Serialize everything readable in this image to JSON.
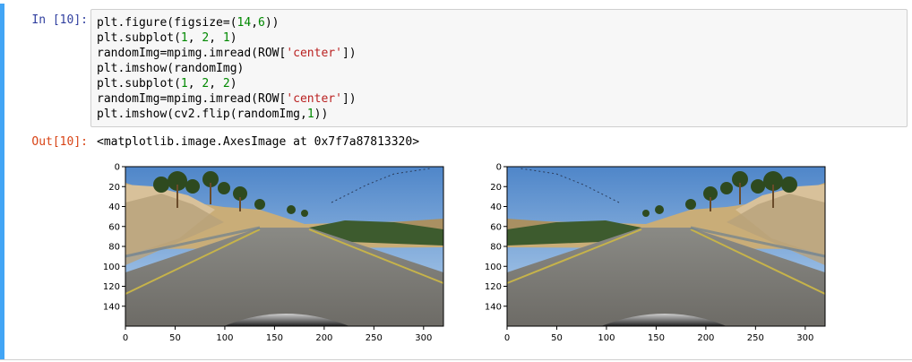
{
  "cell": {
    "in_prompt": "In [10]:",
    "out_prompt": "Out[10]:",
    "code_lines": [
      [
        {
          "t": "plt.figure(figsize=("
        },
        {
          "t": "14",
          "c": "num"
        },
        {
          "t": ","
        },
        {
          "t": "6",
          "c": "num"
        },
        {
          "t": "))"
        }
      ],
      [
        {
          "t": "plt.subplot("
        },
        {
          "t": "1",
          "c": "num"
        },
        {
          "t": ", "
        },
        {
          "t": "2",
          "c": "num"
        },
        {
          "t": ", "
        },
        {
          "t": "1",
          "c": "num"
        },
        {
          "t": ")"
        }
      ],
      [
        {
          "t": "randomImg=mpimg.imread(ROW["
        },
        {
          "t": "'center'",
          "c": "str"
        },
        {
          "t": "])"
        }
      ],
      [
        {
          "t": "plt.imshow(randomImg)"
        }
      ],
      [
        {
          "t": "plt.subplot("
        },
        {
          "t": "1",
          "c": "num"
        },
        {
          "t": ", "
        },
        {
          "t": "2",
          "c": "num"
        },
        {
          "t": ", "
        },
        {
          "t": "2",
          "c": "num"
        },
        {
          "t": ")"
        }
      ],
      [
        {
          "t": "randomImg=mpimg.imread(ROW["
        },
        {
          "t": "'center'",
          "c": "str"
        },
        {
          "t": "])"
        }
      ],
      [
        {
          "t": "plt.imshow("
        },
        {
          "t": "cv2.flip(randomImg,",
          "c": "plain"
        },
        {
          "t": "1",
          "c": "num"
        },
        {
          "t": "))"
        }
      ]
    ],
    "output_text": "<matplotlib.image.AxesImage at 0x7f7a87813320>"
  },
  "plots": {
    "x_ticks": [
      "0",
      "50",
      "100",
      "150",
      "200",
      "250",
      "300"
    ],
    "y_ticks": [
      "0",
      "20",
      "40",
      "60",
      "80",
      "100",
      "120",
      "140"
    ],
    "x_tick_values": [
      0,
      50,
      100,
      150,
      200,
      250,
      300
    ],
    "y_tick_values": [
      0,
      20,
      40,
      60,
      80,
      100,
      120,
      140
    ],
    "image_width": 320,
    "image_height": 160,
    "subplots": [
      {
        "name": "original",
        "flipped": false
      },
      {
        "name": "flipped",
        "flipped": true
      }
    ]
  },
  "colors": {
    "cell_border": "#42a5f5",
    "in_prompt": "#303f9f",
    "out_prompt": "#d84315",
    "number": "#008800",
    "string": "#ba2121"
  }
}
